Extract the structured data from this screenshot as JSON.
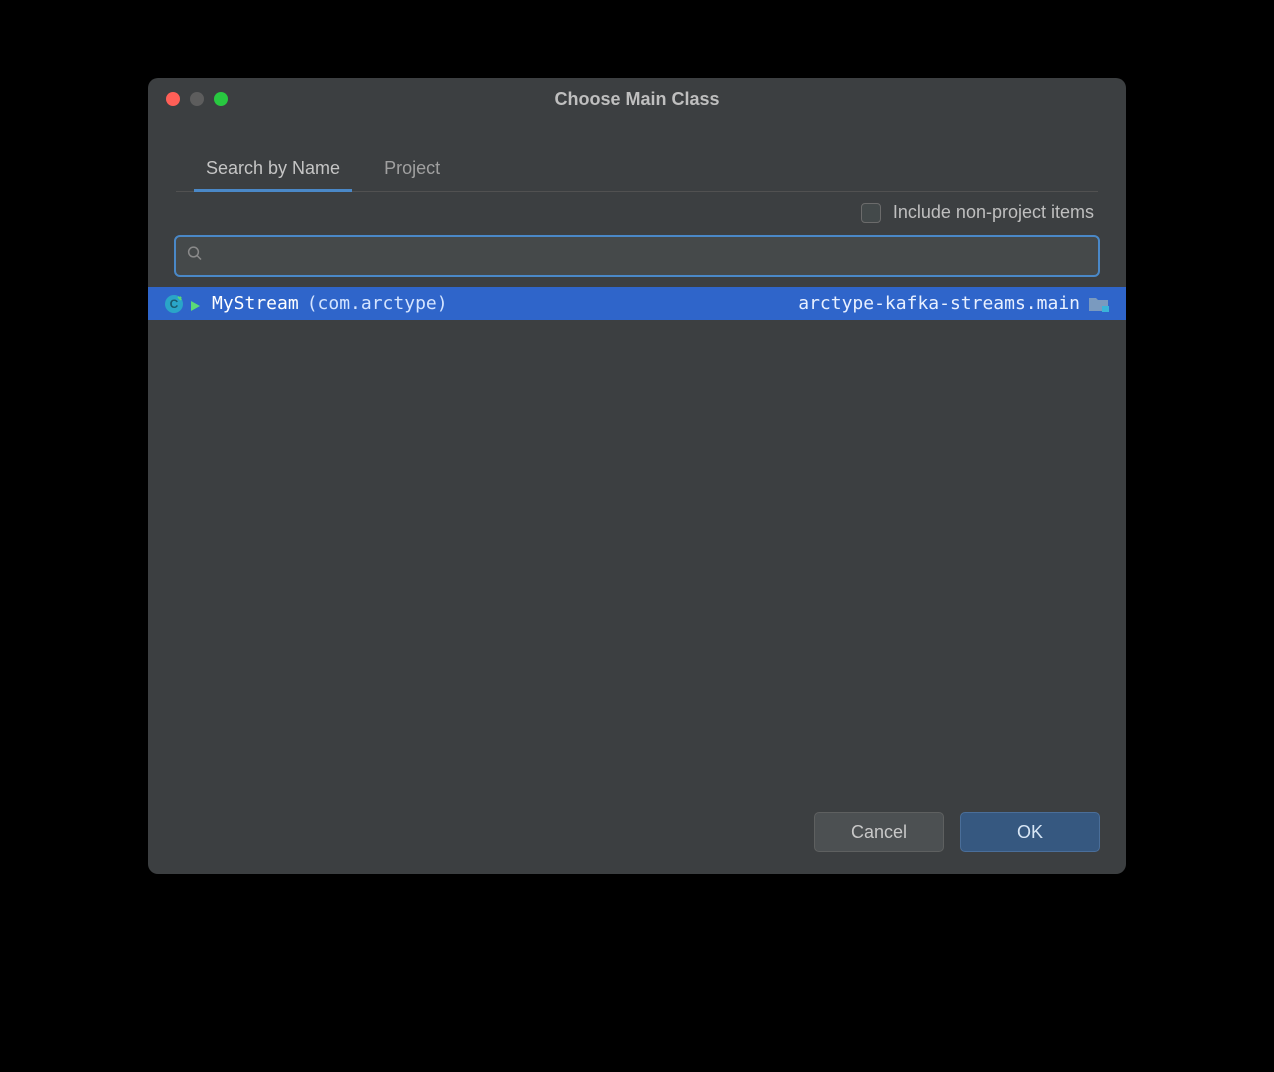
{
  "dialog": {
    "title": "Choose Main Class"
  },
  "tabs": {
    "search": "Search by Name",
    "project": "Project"
  },
  "options": {
    "include_non_project": "Include non-project items"
  },
  "search": {
    "value": "",
    "placeholder": ""
  },
  "results": [
    {
      "name": "MyStream",
      "package": "(com.arctype)",
      "module": "arctype-kafka-streams.main"
    }
  ],
  "buttons": {
    "cancel": "Cancel",
    "ok": "OK"
  }
}
